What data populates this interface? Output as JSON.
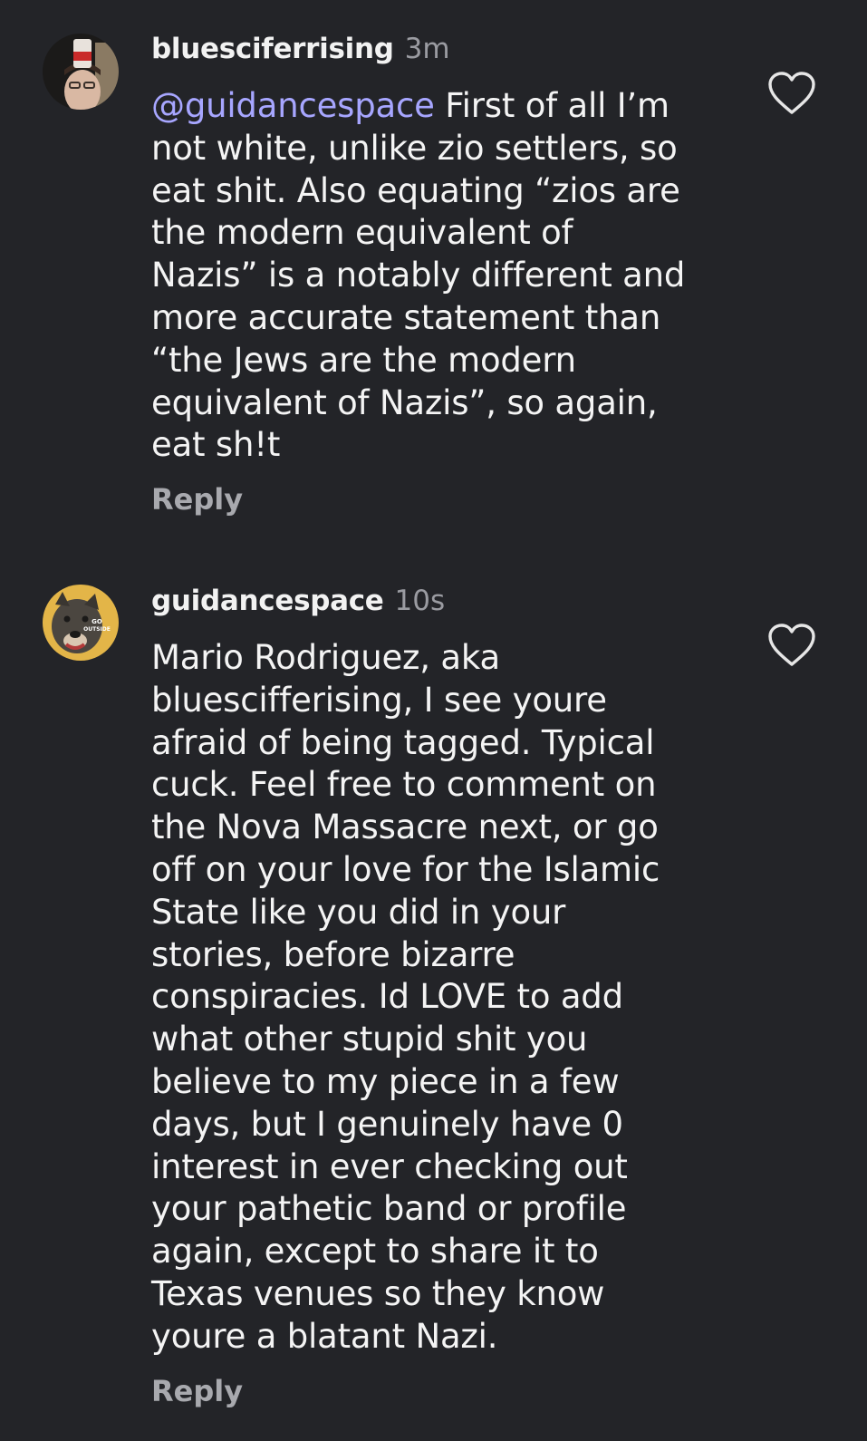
{
  "comments": [
    {
      "username": "bluesciferrising",
      "time": "3m",
      "avatar_icon": "profile-photo",
      "mention": "guidancespace",
      "mention_prefix": "@",
      "lines": [
        " First of all I’m",
        "not white, unlike zio settlers, so",
        "eat shit. Also equating “zios are",
        "the modern equivalent of",
        "Nazis” is a notably different and",
        "more accurate statement than",
        "“the Jews are the modern",
        "equivalent of Nazis”, so again,",
        "eat sh!t"
      ],
      "reply_label": "Reply",
      "like_icon": "heart-outline-icon"
    },
    {
      "username": "guidancespace",
      "time": "10s",
      "avatar_icon": "dog-photo",
      "avatar_text": "GO OUTSIDE",
      "lines": [
        "Mario Rodriguez, aka",
        "bluescifferising, I see youre",
        "afraid of being tagged. Typical",
        "cuck. Feel free to comment on",
        "the Nova Massacre next, or go",
        "off on your love for the Islamic",
        "State like you did in your",
        "stories, before bizarre",
        "conspiracies. Id LOVE to add",
        "what other stupid shit you",
        "believe to my piece in a few",
        "days, but I genuinely have 0",
        "interest in ever checking out",
        "your pathetic band or profile",
        "again, except to share it to",
        "Texas venues so they know",
        "youre a blatant Nazi."
      ],
      "reply_label": "Reply",
      "like_icon": "heart-outline-icon"
    }
  ],
  "colors": {
    "background": "#232428",
    "text": "#f4f4f4",
    "muted": "#9a9ba1",
    "mention": "#a7a6ff"
  }
}
